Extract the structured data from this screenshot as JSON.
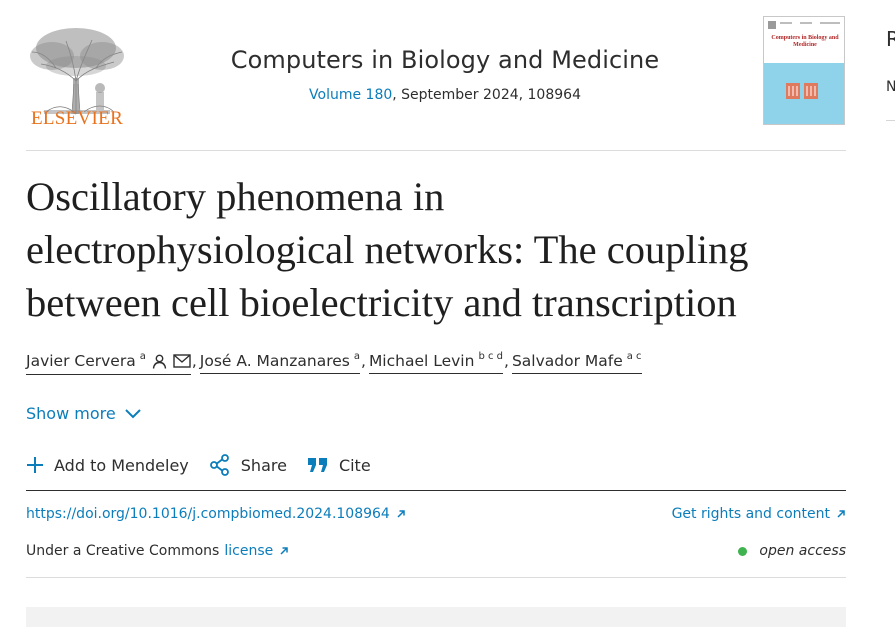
{
  "header": {
    "publisher": "ELSEVIER",
    "journal_title": "Computers in Biology and Medicine",
    "volume_link": "Volume 180",
    "issue_info": ", September 2024, 108964",
    "cover_title": "Computers in Biology and Medicine"
  },
  "side_panel": {
    "heading_initial": "R",
    "item_initial": "N"
  },
  "article": {
    "title_line1": "Oscillatory phenomena in",
    "title_line2": "electrophysiological networks: The coupling",
    "title_line3": "between cell bioelectricity and transcription"
  },
  "authors": [
    {
      "name": "Javier Cervera",
      "affil": "a",
      "icons": [
        "person-icon",
        "envelope-icon"
      ]
    },
    {
      "name": "José A. Manzanares",
      "affil": "a"
    },
    {
      "name": "Michael Levin",
      "affil": "b c d"
    },
    {
      "name": "Salvador Mafe",
      "affil": "a c"
    }
  ],
  "separator": ",",
  "show_more_label": "Show more",
  "actions": {
    "mendeley": "Add to Mendeley",
    "share": "Share",
    "cite": "Cite"
  },
  "links": {
    "doi": "https://doi.org/10.1016/j.compbiomed.2024.108964",
    "rights": "Get rights and content",
    "license_prefix": "Under a Creative Commons",
    "license_link": "license",
    "open_access": "open access"
  },
  "colors": {
    "link": "#0c7dbb",
    "elsevier_orange": "#e9711c",
    "open_access_dot": "#3fb34f"
  }
}
